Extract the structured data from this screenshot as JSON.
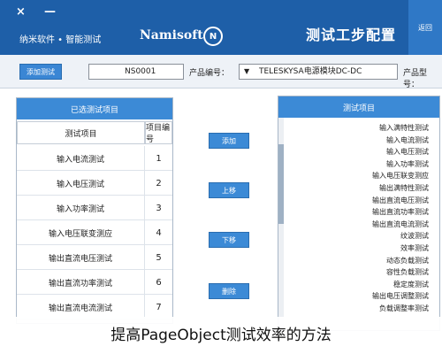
{
  "window": {
    "close_glyph": "×",
    "minimize_glyph": "—",
    "subtitle": "纳米软件 • 智能测试",
    "brand": "Namisoft",
    "logo_glyph": "N",
    "title": "测试工步配置",
    "back_label": "返回"
  },
  "toolbar": {
    "add_test_label": "添加测试",
    "serial_value": "NS0001",
    "serial_label": "产品编号：",
    "model_arrow": "▼",
    "model_value": "TELESKYSA电源模块DC-DC",
    "model_label": "产品型号："
  },
  "selected_panel": {
    "header": "已选测试项目",
    "col_name": "测试项目",
    "col_index": "项目编号",
    "rows": [
      {
        "name": "输入电流测试",
        "index": "1"
      },
      {
        "name": "输入电压测试",
        "index": "2"
      },
      {
        "name": "输入功率测试",
        "index": "3"
      },
      {
        "name": "输入电压联变测应",
        "index": "4"
      },
      {
        "name": "输出直流电压测试",
        "index": "5"
      },
      {
        "name": "输出直流功率测试",
        "index": "6"
      },
      {
        "name": "输出直流电流测试",
        "index": "7"
      }
    ]
  },
  "actions": {
    "add": "添加",
    "up": "上移",
    "down": "下移",
    "delete": "删除"
  },
  "available_panel": {
    "header": "测试项目",
    "items": [
      "输入满特性测试",
      "输入电流测试",
      "输入电压测试",
      "输入功率测试",
      "输入电压联变测应",
      "输出满特性测试",
      "输出直流电压测试",
      "输出直流功率测试",
      "输出直流电流测试",
      "纹波测试",
      "效率测试",
      "动态负载测试",
      "容性负载测试",
      "稳定度测试",
      "输出电压调整测试",
      "负载调整率测试"
    ]
  },
  "caption": "提高PageObject测试效率的方法"
}
